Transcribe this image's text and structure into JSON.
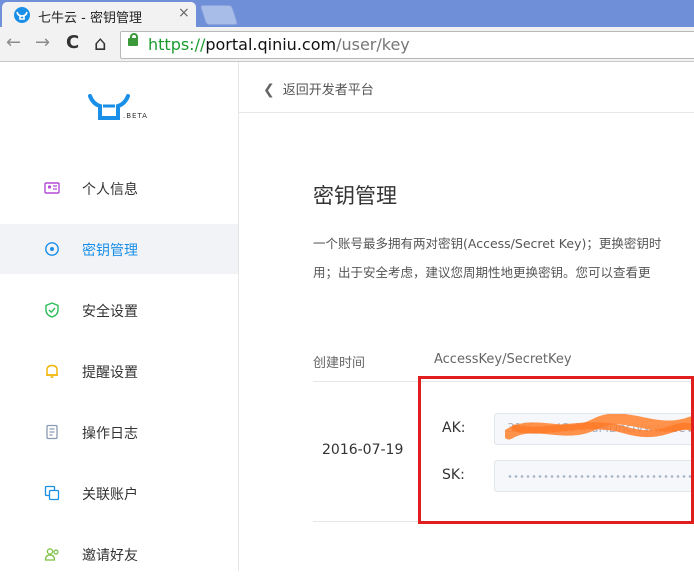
{
  "browser": {
    "tab_title": "七牛云 - 密钥管理",
    "tab_close": "×",
    "url_scheme": "https://",
    "url_host": "portal.qiniu.com",
    "url_path": "/user/key",
    "nav": {
      "back": "←",
      "forward": "→",
      "reload": "C",
      "home": "⌂"
    }
  },
  "sidebar": {
    "logo_beta": ".BETA",
    "items": [
      {
        "label": "个人信息",
        "icon": "id-card-icon",
        "active": false
      },
      {
        "label": "密钥管理",
        "icon": "key-icon",
        "active": true
      },
      {
        "label": "安全设置",
        "icon": "shield-icon",
        "active": false
      },
      {
        "label": "提醒设置",
        "icon": "bell-icon",
        "active": false
      },
      {
        "label": "操作日志",
        "icon": "log-icon",
        "active": false
      },
      {
        "label": "关联账户",
        "icon": "link-accounts-icon",
        "active": false
      },
      {
        "label": "邀请好友",
        "icon": "invite-friends-icon",
        "active": false
      }
    ]
  },
  "main": {
    "back_link": "返回开发者平台",
    "title": "密钥管理",
    "desc_line1": "一个账号最多拥有两对密钥(Access/Secret Key)；更换密钥时",
    "desc_line2": "用；出于安全考虑，建议您周期性地更换密钥。您可以查看更",
    "table": {
      "col_created": "创建时间",
      "col_keys": "AccessKey/SecretKey",
      "rows": [
        {
          "created": "2016-07-19",
          "ak_label": "AK:",
          "ak_value": "31fGxxxJCsKCdMDnciVwwx2eV",
          "sk_label": "SK:"
        }
      ]
    }
  },
  "colors": {
    "accent": "#1a8fe8",
    "highlight": "#e01e1e",
    "tabstrip": "#6f8fd8"
  }
}
